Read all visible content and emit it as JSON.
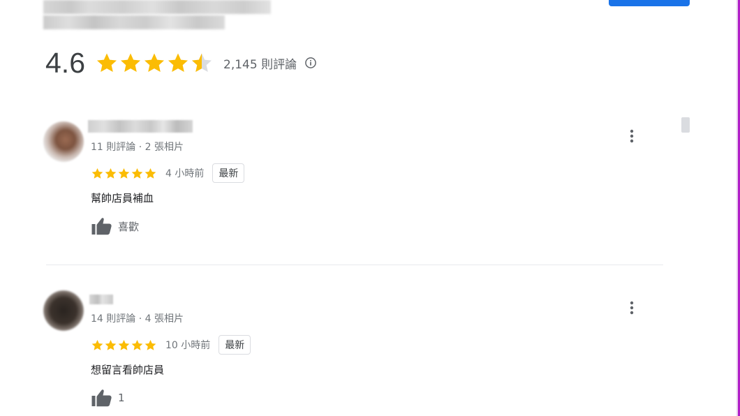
{
  "place": {
    "action_button_color": "#1a73e8"
  },
  "summary": {
    "rating": "4.6",
    "stars_filled": 4.6,
    "review_count": "2,145 則評論",
    "star_color": "#fbbc04"
  },
  "reviews": [
    {
      "meta": "11 則評論 · 2 張相片",
      "stars": 5,
      "time": "4 小時前",
      "badge": "最新",
      "text": "幫帥店員補血",
      "like_label": "喜歡"
    },
    {
      "meta": "14 則評論 · 4 張相片",
      "stars": 5,
      "time": "10 小時前",
      "badge": "最新",
      "text": "想留言看帥店員",
      "like_label": "1"
    }
  ]
}
